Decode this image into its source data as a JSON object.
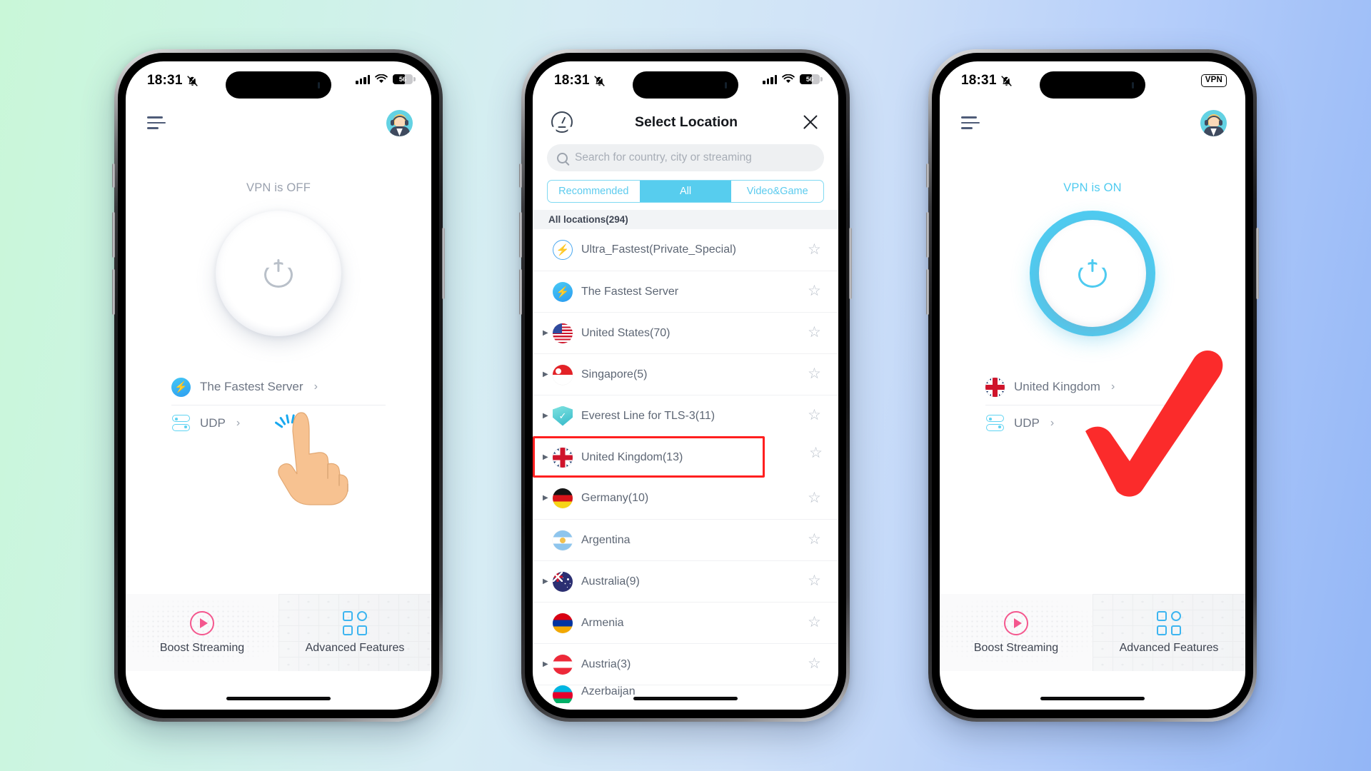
{
  "background": {
    "from": "#c9f7d8",
    "to": "#93b6f6"
  },
  "accent": {
    "cyan": "#4fcbf0",
    "red": "#ff1f1f",
    "pink": "#f4578e",
    "blue": "#3db5f0"
  },
  "phones": [
    {
      "id": "phone-home-off",
      "status_bar": {
        "time": "18:31",
        "mute_icon": "bell-slash-icon",
        "signal_icon": "cellular-bars-icon",
        "wifi_icon": "wifi-icon",
        "battery_level": "56",
        "battery_icon": "battery-icon"
      },
      "header": {
        "menu_icon": "hamburger-menu-icon",
        "avatar_icon": "support-avatar-icon"
      },
      "vpn_status": "VPN is OFF",
      "power_button_icon": "power-icon",
      "rows": [
        {
          "icon": "fastest-server-bolt-icon",
          "label": "The Fastest Server",
          "chevron": "›"
        },
        {
          "icon": "protocol-toggle-icon",
          "label": "UDP",
          "chevron": "›"
        }
      ],
      "promo": [
        {
          "icon": "play-circle-icon",
          "label": "Boost Streaming"
        },
        {
          "icon": "grid-squares-icon",
          "label": "Advanced Features"
        }
      ],
      "annotation": "tap-hand-cursor"
    },
    {
      "id": "phone-select-location",
      "status_bar": {
        "time": "18:31",
        "mute_icon": "bell-slash-icon",
        "signal_icon": "cellular-bars-icon",
        "wifi_icon": "wifi-icon",
        "battery_level": "56",
        "battery_icon": "battery-icon"
      },
      "header": {
        "speed_test_icon": "speedometer-icon",
        "title": "Select Location",
        "close_icon": "close-icon"
      },
      "search": {
        "icon": "search-icon",
        "placeholder": "Search for country, city or streaming",
        "value": ""
      },
      "tabs": [
        {
          "label": "Recommended",
          "active": false
        },
        {
          "label": "All",
          "active": true
        },
        {
          "label": "Video&Game",
          "active": false
        }
      ],
      "list_header": "All locations(294)",
      "locations": [
        {
          "name": "Ultra_Fastest(Private_Special)",
          "icon": "ultra-fastest-icon",
          "expandable": false,
          "starred": false,
          "highlighted": false
        },
        {
          "name": "The Fastest Server",
          "icon": "fastest-server-bolt-icon",
          "expandable": false,
          "starred": false,
          "highlighted": false
        },
        {
          "name": "United States(70)",
          "icon": "flag-us",
          "expandable": true,
          "starred": false,
          "highlighted": false
        },
        {
          "name": "Singapore(5)",
          "icon": "flag-sg",
          "expandable": true,
          "starred": false,
          "highlighted": false
        },
        {
          "name": "Everest Line for TLS-3(11)",
          "icon": "shield-check-icon",
          "expandable": true,
          "starred": false,
          "highlighted": false
        },
        {
          "name": "United Kingdom(13)",
          "icon": "flag-uk",
          "expandable": true,
          "starred": false,
          "highlighted": true
        },
        {
          "name": "Germany(10)",
          "icon": "flag-de",
          "expandable": true,
          "starred": false,
          "highlighted": false
        },
        {
          "name": "Argentina",
          "icon": "flag-ar",
          "expandable": false,
          "starred": false,
          "highlighted": false
        },
        {
          "name": "Australia(9)",
          "icon": "flag-au",
          "expandable": true,
          "starred": false,
          "highlighted": false
        },
        {
          "name": "Armenia",
          "icon": "flag-am",
          "expandable": false,
          "starred": false,
          "highlighted": false
        },
        {
          "name": "Austria(3)",
          "icon": "flag-at",
          "expandable": true,
          "starred": false,
          "highlighted": false
        },
        {
          "name": "Azerbaijan",
          "icon": "flag-az",
          "expandable": false,
          "starred": false,
          "highlighted": false
        }
      ],
      "star_icon": "star-outline-icon"
    },
    {
      "id": "phone-home-on",
      "status_bar": {
        "time": "18:31",
        "mute_icon": "bell-slash-icon",
        "vpn_badge": "VPN"
      },
      "header": {
        "menu_icon": "hamburger-menu-icon",
        "avatar_icon": "support-avatar-icon"
      },
      "vpn_status": "VPN is ON",
      "power_button_icon": "power-icon",
      "rows": [
        {
          "icon": "flag-uk",
          "label": "United Kingdom",
          "chevron": "›"
        },
        {
          "icon": "protocol-toggle-icon",
          "label": "UDP",
          "chevron": "›"
        }
      ],
      "promo": [
        {
          "icon": "play-circle-icon",
          "label": "Boost Streaming"
        },
        {
          "icon": "grid-squares-icon",
          "label": "Advanced Features"
        }
      ],
      "annotation": "red-checkmark"
    }
  ]
}
